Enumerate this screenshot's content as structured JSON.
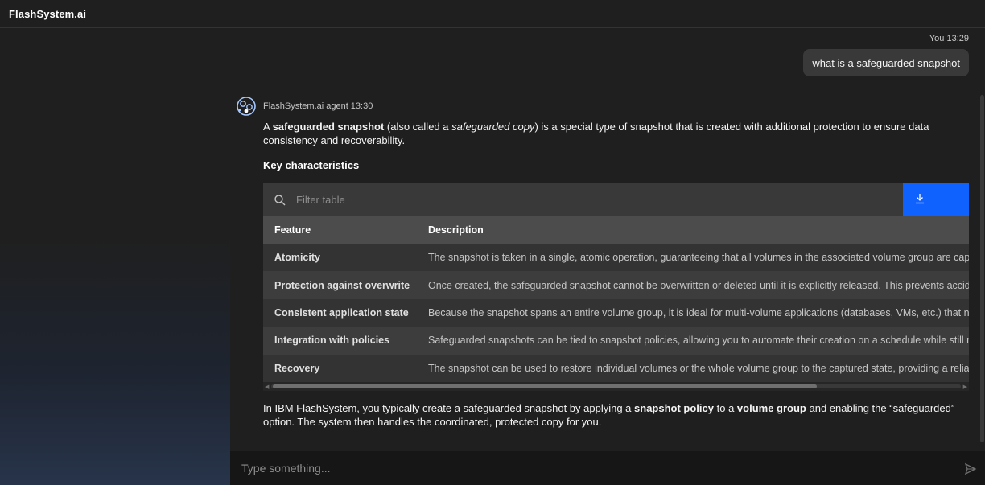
{
  "app": {
    "title": "FlashSystem.ai"
  },
  "user_message": {
    "sender": "You",
    "time": "13:29",
    "text": "what is a safeguarded snapshot"
  },
  "agent_message": {
    "sender": "FlashSystem.ai agent",
    "time": "13:30",
    "intro": {
      "p1": "A ",
      "b1": "safeguarded snapshot",
      "p2": " (also called a ",
      "i1": "safeguarded copy",
      "p3": ") is a special type of snapshot that is created with additional protection to ensure data consistency and recoverability."
    },
    "section_title": "Key characteristics",
    "table": {
      "filter_placeholder": "Filter table",
      "columns": [
        "Feature",
        "Description"
      ],
      "rows": [
        {
          "feature": "Atomicity",
          "description": "The snapshot is taken in a single, atomic operation, guaranteeing that all volumes in the associated volume group are capt"
        },
        {
          "feature": "Protection against overwrite",
          "description": "Once created, the safeguarded snapshot cannot be overwritten or deleted until it is explicitly released. This prevents accid"
        },
        {
          "feature": "Consistent application state",
          "description": "Because the snapshot spans an entire volume group, it is ideal for multi-volume applications (databases, VMs, etc.) that ne"
        },
        {
          "feature": "Integration with policies",
          "description": "Safeguarded snapshots can be tied to snapshot policies, allowing you to automate their creation on a schedule while still r"
        },
        {
          "feature": "Recovery",
          "description": "The snapshot can be used to restore individual volumes or the whole volume group to the captured state, providing a relial"
        }
      ]
    },
    "closing": {
      "p1": "In IBM FlashSystem, you typically create a safeguarded snapshot by applying a ",
      "b1": "snapshot policy",
      "p2": " to a ",
      "b2": "volume group",
      "p3": " and enabling the “safeguarded” option. The system then handles the coordinated, protected copy for you."
    }
  },
  "composer": {
    "placeholder": "Type something..."
  },
  "icons": {
    "avatar": "agent-avatar-icon",
    "search": "search-icon",
    "download": "download-icon",
    "send": "send-icon"
  },
  "colors": {
    "accent": "#0f62fe",
    "avatar": "#a6c8ff"
  }
}
